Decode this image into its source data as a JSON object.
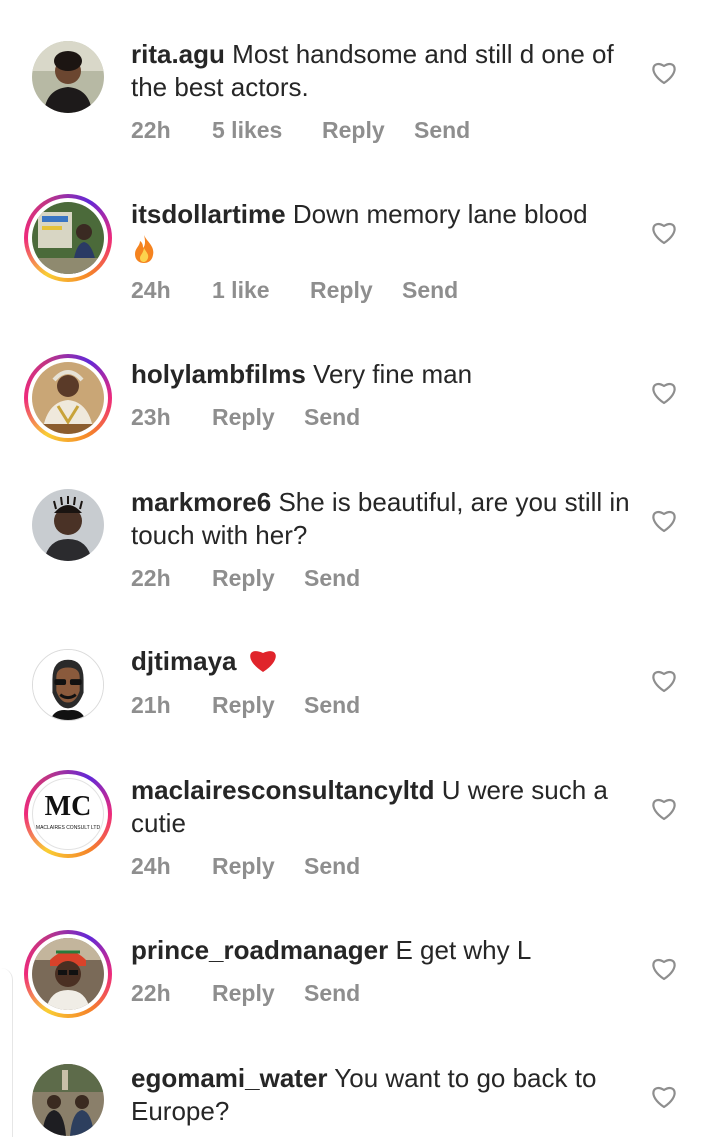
{
  "comments": [
    {
      "username": "rita.agu",
      "text": "Most handsome and still d one of the best actors.",
      "time": "22h",
      "likes": "5 likes",
      "reply": "Reply",
      "send": "Send"
    },
    {
      "username": "itsdollartime",
      "text": "Down memory lane blood",
      "emoji": "🔥",
      "time": "24h",
      "likes": "1 like",
      "reply": "Reply",
      "send": "Send"
    },
    {
      "username": "holylambfilms",
      "text": "Very fine man",
      "time": "23h",
      "reply": "Reply",
      "send": "Send"
    },
    {
      "username": "markmore6",
      "text": "She is beautiful, are you still in touch with her?",
      "time": "22h",
      "reply": "Reply",
      "send": "Send"
    },
    {
      "username": "djtimaya",
      "text": "",
      "emoji": "❤️",
      "time": "21h",
      "reply": "Reply",
      "send": "Send"
    },
    {
      "username": "maclairesconsultancyltd",
      "text": "U were such a cutie",
      "time": "24h",
      "reply": "Reply",
      "send": "Send"
    },
    {
      "username": "prince_roadmanager",
      "text": "E get why L",
      "time": "22h",
      "reply": "Reply",
      "send": "Send"
    },
    {
      "username": "egomami_water",
      "text": "You want to go back to Europe?",
      "time": "",
      "reply": "",
      "send": ""
    }
  ],
  "logo_text": {
    "monogram": "MC",
    "caption": "MACLAIRES CONSULT LTD"
  },
  "colors": {
    "text": "#262626",
    "meta": "#8e8e8e",
    "heart_outline": "#8e8e8e",
    "emoji_heart": "#e0242b",
    "fire": "#f5831f"
  }
}
